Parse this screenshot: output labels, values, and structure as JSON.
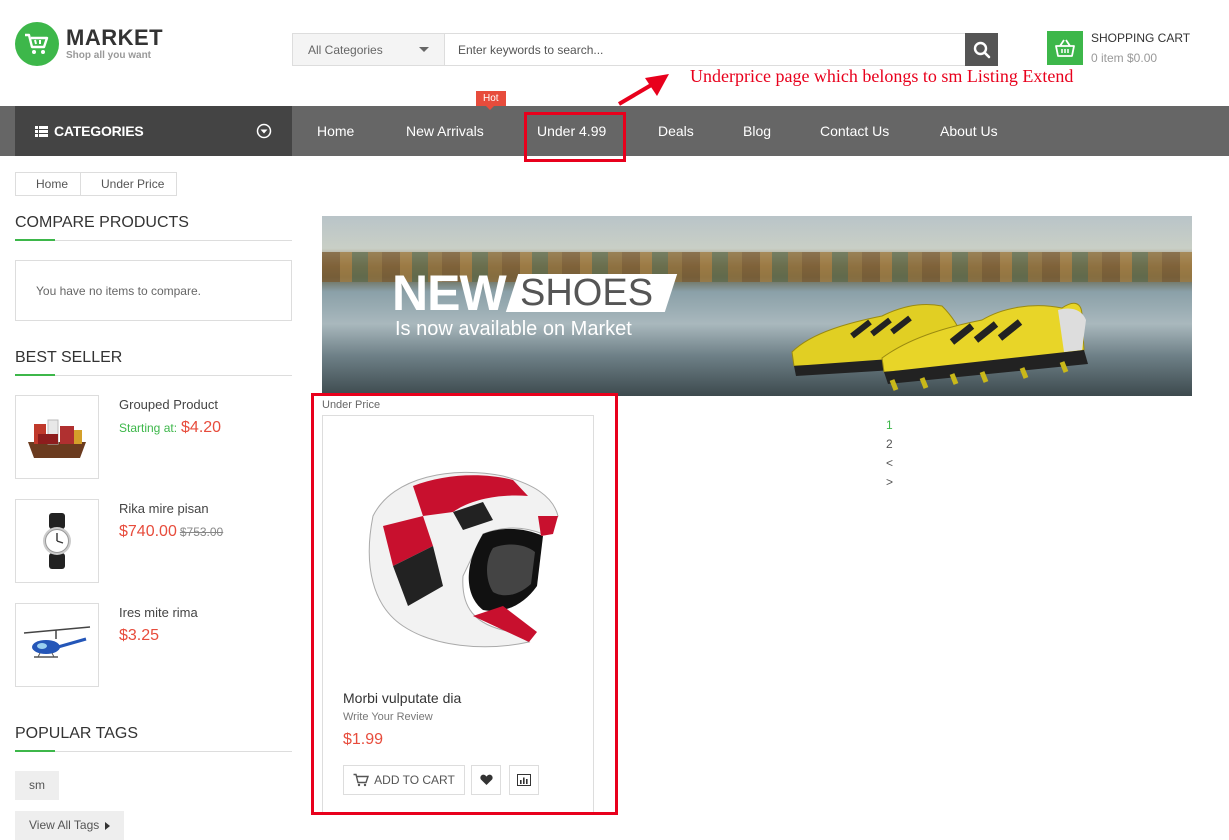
{
  "header": {
    "logo_title": "MARKET",
    "logo_subtitle": "Shop all you want",
    "search": {
      "category": "All Categories",
      "placeholder": "Enter keywords to search..."
    },
    "cart": {
      "title": "SHOPPING CART",
      "summary": "0 item $0.00"
    }
  },
  "annotation": "Underprice page which belongs to sm Listing Extend",
  "nav": {
    "categories_label": "CATEGORIES",
    "hot_badge": "Hot",
    "items": [
      "Home",
      "New Arrivals",
      "Under 4.99",
      "Deals",
      "Blog",
      "Contact Us",
      "About Us"
    ]
  },
  "breadcrumb": [
    "Home",
    "Under Price"
  ],
  "sidebar": {
    "compare": {
      "title": "COMPARE PRODUCTS",
      "empty_text": "You have no items to compare."
    },
    "best_seller": {
      "title": "BEST SELLER",
      "items": [
        {
          "name": "Grouped Product",
          "starting": "Starting at:",
          "price": "$4.20",
          "old_price": ""
        },
        {
          "name": "Rika mire pisan",
          "starting": "",
          "price": "$740.00",
          "old_price": "$753.00"
        },
        {
          "name": "Ires mite rima",
          "starting": "",
          "price": "$3.25",
          "old_price": ""
        }
      ]
    },
    "tags": {
      "title": "POPULAR TAGS",
      "items": [
        "sm"
      ],
      "view_all": "View All Tags"
    }
  },
  "banner": {
    "headline_bold": "NEW",
    "headline_light": "SHOES",
    "subline": "Is now available on Market"
  },
  "listing": {
    "label": "Under Price",
    "product": {
      "name": "Morbi vulputate dia",
      "review": "Write Your Review",
      "price": "$1.99",
      "add_to_cart": "ADD TO CART"
    },
    "pager": [
      "1",
      "2",
      "<",
      ">"
    ]
  },
  "colors": {
    "accent": "#3db74a",
    "price": "#e74c3c",
    "nav": "#666666",
    "annotation": "#e8001c"
  }
}
